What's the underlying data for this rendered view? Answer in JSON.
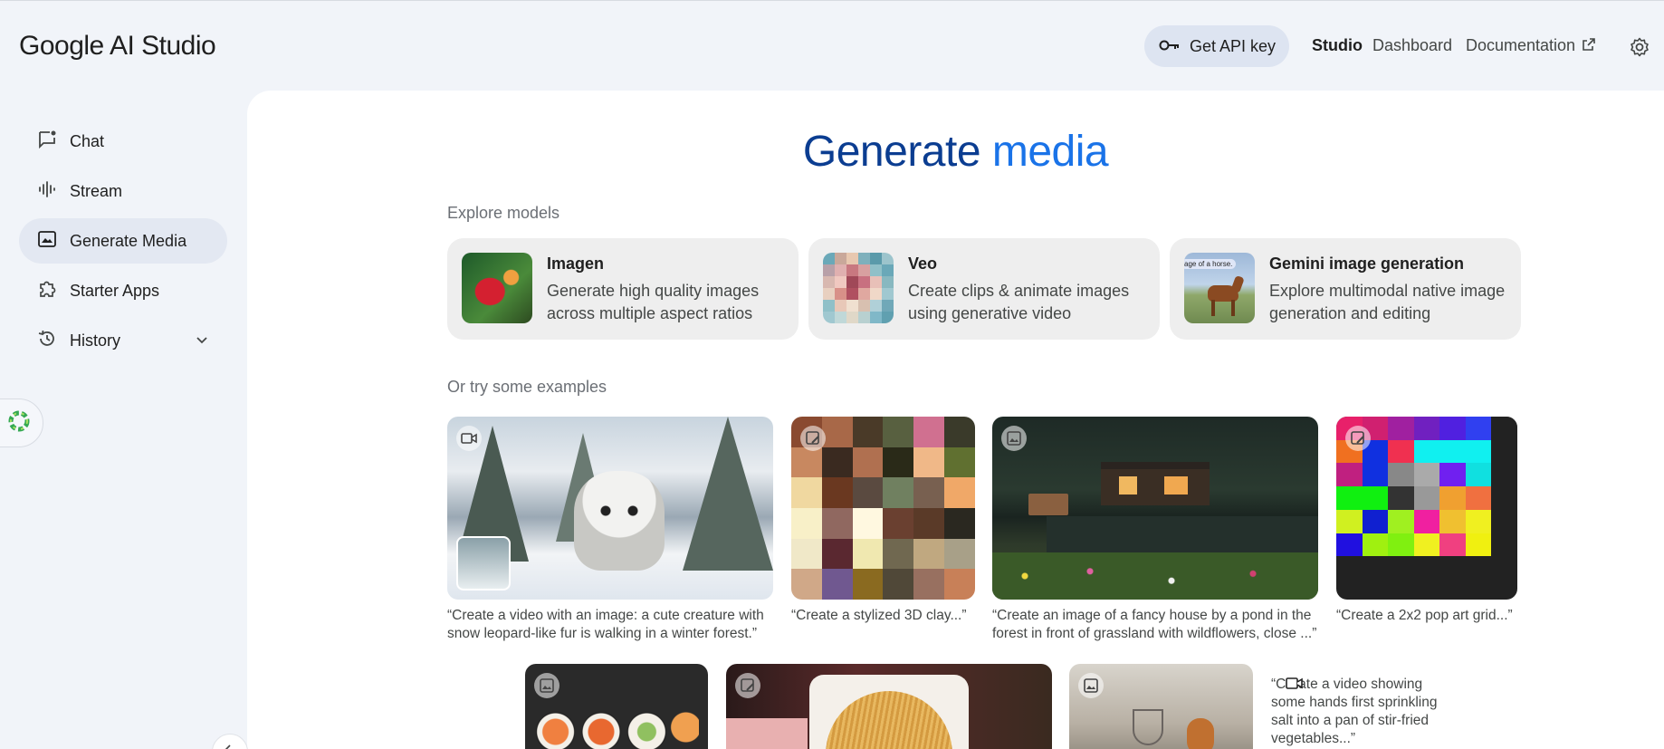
{
  "header": {
    "logo_google": "Google",
    "logo_rest": "AI Studio",
    "api_key_label": "Get API key",
    "nav": {
      "studio": "Studio",
      "dashboard": "Dashboard",
      "documentation": "Documentation"
    }
  },
  "sidebar": {
    "items": [
      {
        "label": "Chat",
        "icon": "chat-icon"
      },
      {
        "label": "Stream",
        "icon": "waveform-icon"
      },
      {
        "label": "Generate Media",
        "icon": "image-icon",
        "active": true
      },
      {
        "label": "Starter Apps",
        "icon": "puzzle-icon"
      },
      {
        "label": "History",
        "icon": "history-icon"
      }
    ]
  },
  "main": {
    "title_part1": "Generate ",
    "title_part2": "media",
    "explore_label": "Explore models",
    "models": [
      {
        "name": "Imagen",
        "desc": "Generate high quality images across multiple aspect ratios"
      },
      {
        "name": "Veo",
        "desc": "Create clips & animate images using generative video"
      },
      {
        "name": "Gemini image generation",
        "desc": "Explore multimodal native image generation and editing",
        "thumb_text": "age of a horse."
      }
    ],
    "examples_label": "Or try some examples",
    "examples": [
      {
        "caption": "“Create a video with an image: a cute creature with snow leopard-like fur is walking in a winter forest.”",
        "icon": "video-icon"
      },
      {
        "caption": "“Create a stylized 3D clay...”",
        "icon": "image-edit-icon"
      },
      {
        "caption": "“Create an image of a fancy house by a pond in the forest in front of grassland with wildflowers, close ...”",
        "icon": "image-icon"
      },
      {
        "caption": "“Create a 2x2 pop art grid...”",
        "icon": "image-edit-icon"
      },
      {
        "caption": "",
        "icon": "image-icon"
      },
      {
        "caption": "",
        "icon": "image-edit-icon"
      },
      {
        "caption": "",
        "icon": "image-icon"
      },
      {
        "caption": "“Create a video showing some hands first sprinkling salt into a pan of stir-fried vegetables...”",
        "icon": "video-icon"
      }
    ]
  },
  "colors": {
    "accent": "#1a73e8",
    "title_dark": "#0b3d91",
    "active_nav": "#e3e8f2",
    "card_bg": "#eeeeee"
  }
}
